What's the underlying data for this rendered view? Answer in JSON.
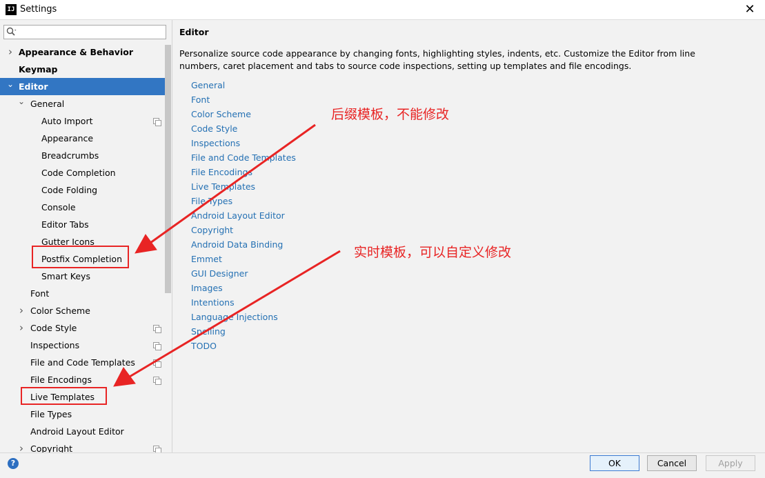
{
  "window": {
    "title": "Settings",
    "app_icon": "intellij-logo",
    "close_glyph": "✕"
  },
  "search": {
    "placeholder": "",
    "value": ""
  },
  "tree": [
    {
      "label": "Appearance & Behavior",
      "level": 0,
      "bold": true,
      "expandable": true,
      "expanded": false,
      "selected": false,
      "copy_icon": false
    },
    {
      "label": "Keymap",
      "level": 0,
      "bold": true,
      "expandable": false,
      "expanded": false,
      "selected": false,
      "copy_icon": false
    },
    {
      "label": "Editor",
      "level": 0,
      "bold": true,
      "expandable": true,
      "expanded": true,
      "selected": true,
      "copy_icon": false
    },
    {
      "label": "General",
      "level": 1,
      "bold": false,
      "expandable": true,
      "expanded": true,
      "selected": false,
      "copy_icon": false
    },
    {
      "label": "Auto Import",
      "level": 2,
      "bold": false,
      "expandable": false,
      "expanded": false,
      "selected": false,
      "copy_icon": true
    },
    {
      "label": "Appearance",
      "level": 2,
      "bold": false,
      "expandable": false,
      "expanded": false,
      "selected": false,
      "copy_icon": false
    },
    {
      "label": "Breadcrumbs",
      "level": 2,
      "bold": false,
      "expandable": false,
      "expanded": false,
      "selected": false,
      "copy_icon": false
    },
    {
      "label": "Code Completion",
      "level": 2,
      "bold": false,
      "expandable": false,
      "expanded": false,
      "selected": false,
      "copy_icon": false
    },
    {
      "label": "Code Folding",
      "level": 2,
      "bold": false,
      "expandable": false,
      "expanded": false,
      "selected": false,
      "copy_icon": false
    },
    {
      "label": "Console",
      "level": 2,
      "bold": false,
      "expandable": false,
      "expanded": false,
      "selected": false,
      "copy_icon": false
    },
    {
      "label": "Editor Tabs",
      "level": 2,
      "bold": false,
      "expandable": false,
      "expanded": false,
      "selected": false,
      "copy_icon": false
    },
    {
      "label": "Gutter Icons",
      "level": 2,
      "bold": false,
      "expandable": false,
      "expanded": false,
      "selected": false,
      "copy_icon": false
    },
    {
      "label": "Postfix Completion",
      "level": 2,
      "bold": false,
      "expandable": false,
      "expanded": false,
      "selected": false,
      "copy_icon": false
    },
    {
      "label": "Smart Keys",
      "level": 2,
      "bold": false,
      "expandable": false,
      "expanded": false,
      "selected": false,
      "copy_icon": false
    },
    {
      "label": "Font",
      "level": 1,
      "bold": false,
      "expandable": false,
      "expanded": false,
      "selected": false,
      "copy_icon": false
    },
    {
      "label": "Color Scheme",
      "level": 1,
      "bold": false,
      "expandable": true,
      "expanded": false,
      "selected": false,
      "copy_icon": false
    },
    {
      "label": "Code Style",
      "level": 1,
      "bold": false,
      "expandable": true,
      "expanded": false,
      "selected": false,
      "copy_icon": true
    },
    {
      "label": "Inspections",
      "level": 1,
      "bold": false,
      "expandable": false,
      "expanded": false,
      "selected": false,
      "copy_icon": true
    },
    {
      "label": "File and Code Templates",
      "level": 1,
      "bold": false,
      "expandable": false,
      "expanded": false,
      "selected": false,
      "copy_icon": true
    },
    {
      "label": "File Encodings",
      "level": 1,
      "bold": false,
      "expandable": false,
      "expanded": false,
      "selected": false,
      "copy_icon": true
    },
    {
      "label": "Live Templates",
      "level": 1,
      "bold": false,
      "expandable": false,
      "expanded": false,
      "selected": false,
      "copy_icon": false
    },
    {
      "label": "File Types",
      "level": 1,
      "bold": false,
      "expandable": false,
      "expanded": false,
      "selected": false,
      "copy_icon": false
    },
    {
      "label": "Android Layout Editor",
      "level": 1,
      "bold": false,
      "expandable": false,
      "expanded": false,
      "selected": false,
      "copy_icon": false
    },
    {
      "label": "Copyright",
      "level": 1,
      "bold": false,
      "expandable": true,
      "expanded": false,
      "selected": false,
      "copy_icon": true
    }
  ],
  "content": {
    "title": "Editor",
    "description": "Personalize source code appearance by changing fonts, highlighting styles, indents, etc. Customize the Editor from line numbers, caret placement and tabs to source code inspections, setting up templates and file encodings.",
    "links": [
      "General",
      "Font",
      "Color Scheme",
      "Code Style",
      "Inspections",
      "File and Code Templates",
      "File Encodings",
      "Live Templates",
      "File Types",
      "Android Layout Editor",
      "Copyright",
      "Android Data Binding",
      "Emmet",
      "GUI Designer",
      "Images",
      "Intentions",
      "Language Injections",
      "Spelling",
      "TODO"
    ]
  },
  "buttons": {
    "ok": "OK",
    "cancel": "Cancel",
    "apply": "Apply",
    "help": "?"
  },
  "annotations": {
    "postfix_note": "后缀模板，不能修改",
    "live_note": "实时模板，可以自定义修改",
    "color": "#e82424"
  },
  "colors": {
    "selection": "#3276c3",
    "link": "#2470b3",
    "panel": "#f2f2f2"
  }
}
